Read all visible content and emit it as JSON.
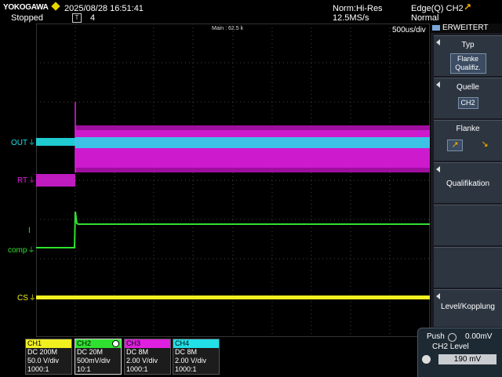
{
  "header": {
    "brand": "YOKOGAWA",
    "datetime": "2025/08/28 16:51:41",
    "run_state": "Stopped",
    "trigger_pos_marker": "T",
    "record_count": "4",
    "acq_mode": "Norm:Hi-Res",
    "sample_rate": "12.5MS/s",
    "trigger": "Edge(Q) CH2",
    "trigger_mode": "Normal"
  },
  "display": {
    "main_label": "Main : 62.5 k",
    "timebase": "500us/div"
  },
  "traces": [
    {
      "label": "OUT",
      "color": "#22e0e8"
    },
    {
      "label": "RT",
      "color": "#e020e0"
    },
    {
      "label": "I",
      "color": "#30e030"
    },
    {
      "label": "comp",
      "color": "#30e030"
    },
    {
      "label": "CS",
      "color": "#f0f020"
    }
  ],
  "menu": {
    "title": "ERWEITERT",
    "typ": {
      "title": "Typ",
      "value": "Flanke Qualifiz."
    },
    "quelle": {
      "title": "Quelle",
      "value": "CH2"
    },
    "flanke": {
      "title": "Flanke",
      "rise_icon": "rising-edge-icon",
      "fall_icon": "falling-edge-icon"
    },
    "qualifikation": {
      "title": "Qualifikation"
    },
    "level_kopplung": {
      "title": "Level/Kopplung"
    }
  },
  "level": {
    "push_label": "Push",
    "push_value": "0.00mV",
    "title": "CH2 Level",
    "value": "190 mV"
  },
  "channels": [
    {
      "name": "CH1",
      "coupling": "DC 200M",
      "scale": "50.0 V/div",
      "probe": "1000:1",
      "color": "#f0f020"
    },
    {
      "name": "CH2",
      "coupling": "DC 20M",
      "scale": "500mV/div",
      "probe": "10:1",
      "color": "#30e030"
    },
    {
      "name": "CH3",
      "coupling": "DC 8M",
      "scale": "2.00 V/div",
      "probe": "1000:1",
      "color": "#e020e0"
    },
    {
      "name": "CH4",
      "coupling": "DC 8M",
      "scale": "2.00 V/div",
      "probe": "1000:1",
      "color": "#22e0e8"
    }
  ]
}
